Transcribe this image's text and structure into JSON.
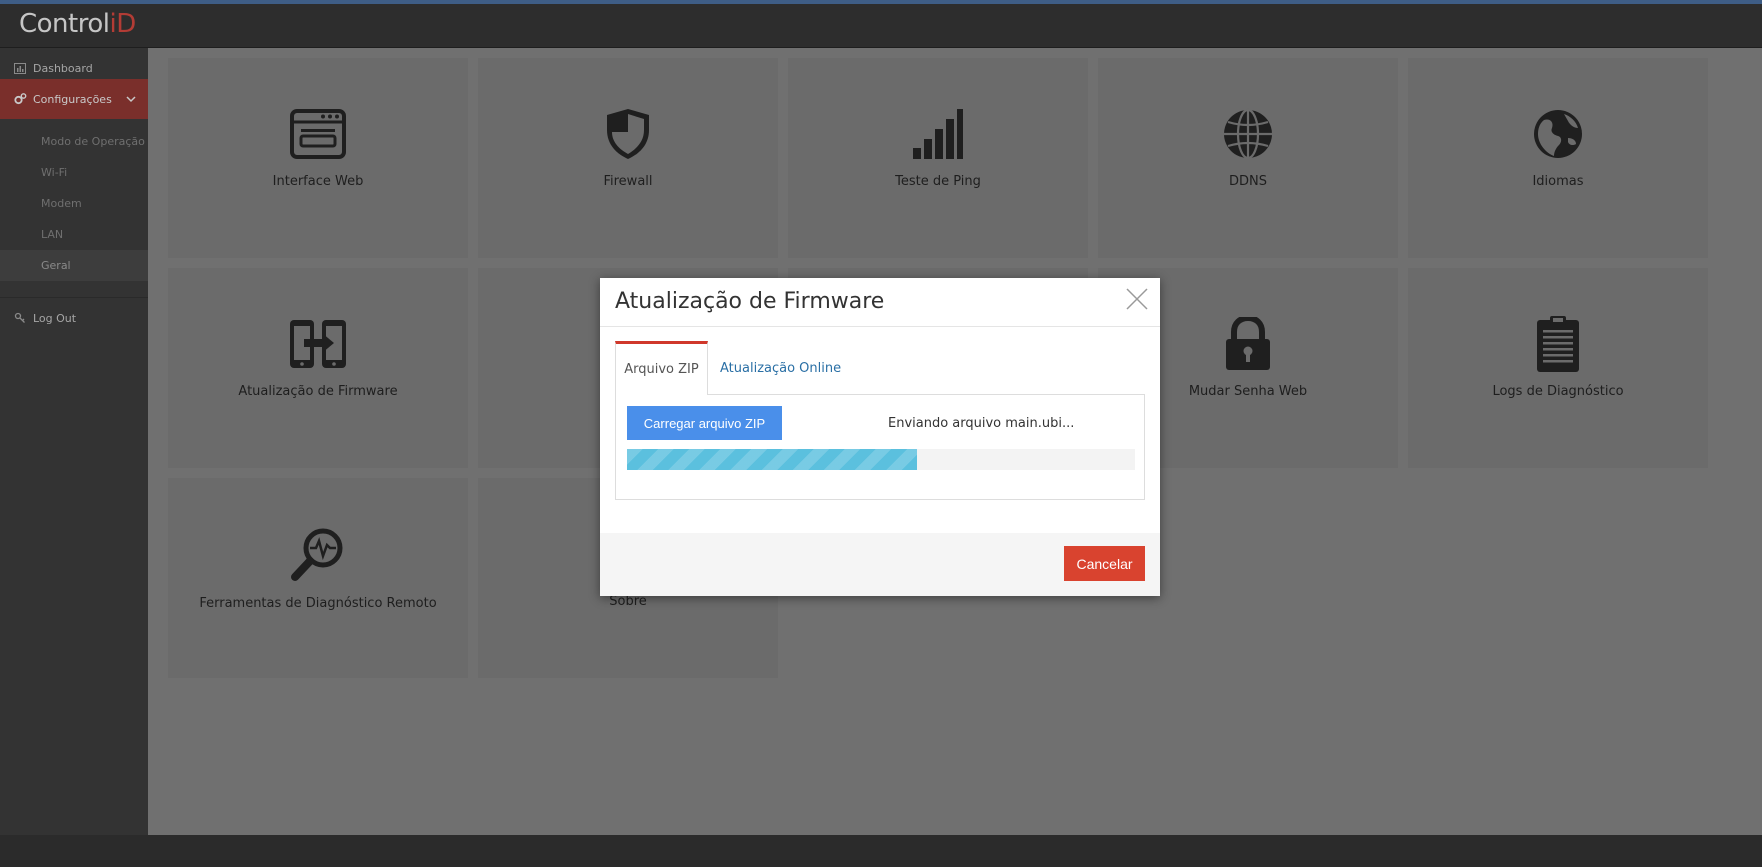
{
  "header": {
    "logo_text": "Control",
    "logo_accent": "iD"
  },
  "sidebar": {
    "items": [
      {
        "label": "Dashboard",
        "icon": "chart-icon"
      },
      {
        "label": "Configurações",
        "icon": "gears-icon"
      },
      {
        "label": "Log Out",
        "icon": "key-icon"
      }
    ],
    "subitems": [
      {
        "label": "Modo de Operação"
      },
      {
        "label": "Wi-Fi"
      },
      {
        "label": "Modem"
      },
      {
        "label": "LAN"
      },
      {
        "label": "Geral"
      }
    ]
  },
  "tiles": [
    {
      "label": "Interface Web",
      "icon": "browser-window-icon"
    },
    {
      "label": "Firewall",
      "icon": "shield-icon"
    },
    {
      "label": "Teste de Ping",
      "icon": "signal-bars-icon"
    },
    {
      "label": "DDNS",
      "icon": "globe-icon"
    },
    {
      "label": "Idiomas",
      "icon": "earth-icon"
    },
    {
      "label": "Atualização de Firmware",
      "icon": "device-transfer-icon"
    },
    {
      "label": "Mudar Senha Web",
      "icon": "lock-icon"
    },
    {
      "label": "Logs de Diagnóstico",
      "icon": "clipboard-icon"
    },
    {
      "label": "Ferramentas de Diagnóstico Remoto",
      "icon": "magnifier-pulse-icon"
    },
    {
      "label": "Sobre",
      "icon": "info-icon"
    }
  ],
  "modal": {
    "title": "Atualização de Firmware",
    "tabs": [
      {
        "label": "Arquivo ZIP"
      },
      {
        "label": "Atualização Online"
      }
    ],
    "upload_button": "Carregar arquivo ZIP",
    "status_text": "Enviando arquivo main.ubi...",
    "progress_fraction": 0.57,
    "cancel_button": "Cancelar"
  },
  "colors": {
    "accent_red": "#d9432f",
    "active_nav": "#7a2f2b",
    "primary_blue": "#4a8fea",
    "progress_cyan": "#5bc0de",
    "link_blue": "#2a6fa5"
  }
}
